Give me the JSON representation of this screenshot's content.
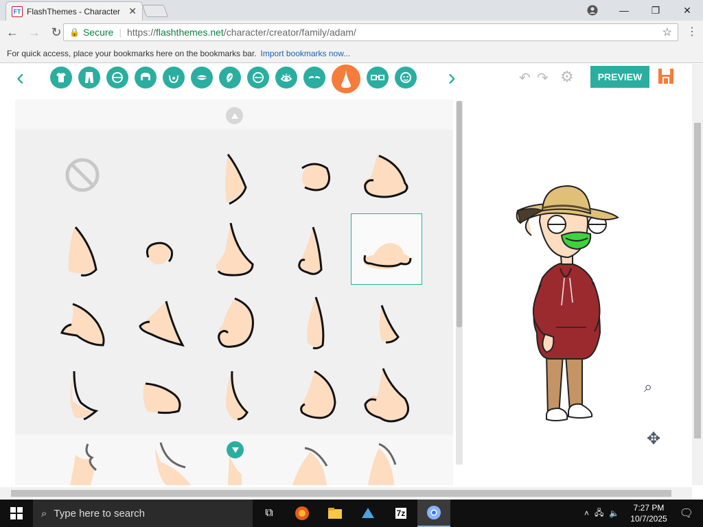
{
  "browser": {
    "tab_title": "FlashThemes - Character",
    "tab_favicon": "FT",
    "secure_label": "Secure",
    "url_scheme": "https://",
    "url_host": "flashthemes.net",
    "url_path": "/character/creator/family/adam/",
    "bookmarks_hint": "For quick access, place your bookmarks here on the bookmarks bar.",
    "bookmarks_link": "Import bookmarks now..."
  },
  "editor": {
    "categories": [
      "shirt-icon",
      "pants-icon",
      "face-shape-icon",
      "hair-icon",
      "beard-icon",
      "mouth-icon",
      "skin-icon",
      "mouth-line-icon",
      "eye-icon",
      "eyebrow-icon",
      "nose-icon",
      "glasses-icon",
      "accessory-icon"
    ],
    "active_category": "nose-icon",
    "preview_label": "PREVIEW",
    "accent_color": "#2aaea0",
    "active_color": "#f57c3a",
    "skin_color": "#fddcbf"
  },
  "nose_grid": {
    "selected": "row2-col5",
    "rows": 4,
    "cols": 5
  },
  "taskbar": {
    "search_placeholder": "Type here to search",
    "time": "7:27 PM",
    "date": "10/7/2025"
  }
}
